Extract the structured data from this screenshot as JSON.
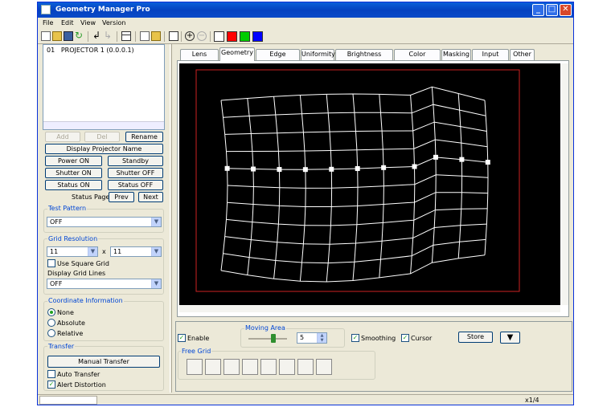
{
  "window": {
    "title": "Geometry Manager Pro"
  },
  "menu": [
    "File",
    "Edit",
    "View",
    "Version"
  ],
  "colors": {
    "swatches": [
      "#ffffff",
      "#ff0000",
      "#00cc00",
      "#0000ff"
    ],
    "accent": "#0046d5",
    "canvas": "#000000",
    "grid": "#ffffff",
    "frame": "#cc2222"
  },
  "projectors": [
    {
      "id": "01",
      "name": "PROJECTOR 1 (0.0.0.1)"
    }
  ],
  "list_buttons": {
    "add": "Add",
    "del": "Del",
    "rename": "Rename"
  },
  "controls": {
    "display_name": "Display Projector Name",
    "power_on": "Power ON",
    "standby": "Standby",
    "shutter_on": "Shutter ON",
    "shutter_off": "Shutter OFF",
    "status_on": "Status ON",
    "status_off": "Status OFF",
    "status_page": "Status Page",
    "prev": "Prev",
    "next": "Next"
  },
  "test_pattern": {
    "label": "Test Pattern",
    "value": "OFF"
  },
  "grid_resolution": {
    "label": "Grid Resolution",
    "cols": "11",
    "x": "x",
    "rows": "11",
    "square": "Use Square Grid",
    "display_lines_label": "Display Grid Lines",
    "display_lines_value": "OFF"
  },
  "coordinate": {
    "label": "Coordinate Information",
    "options": [
      "None",
      "Absolute",
      "Relative"
    ],
    "selected": 0
  },
  "transfer": {
    "label": "Transfer",
    "manual": "Manual Transfer",
    "auto": "Auto Transfer",
    "alert": "Alert Distortion"
  },
  "tabs": [
    "Lens Setting",
    "Geometry",
    "Edge Blending",
    "Uniformity",
    "Brightness Control",
    "Color Matching",
    "Masking",
    "Input Signal",
    "Other"
  ],
  "selected_tab": 1,
  "bottom": {
    "enable": "Enable",
    "moving_area_label": "Moving Area",
    "moving_area_value": "5",
    "smoothing": "Smoothing",
    "cursor": "Cursor",
    "store": "Store",
    "free_grid_label": "Free Grid"
  },
  "status": {
    "page": "x1/4"
  }
}
